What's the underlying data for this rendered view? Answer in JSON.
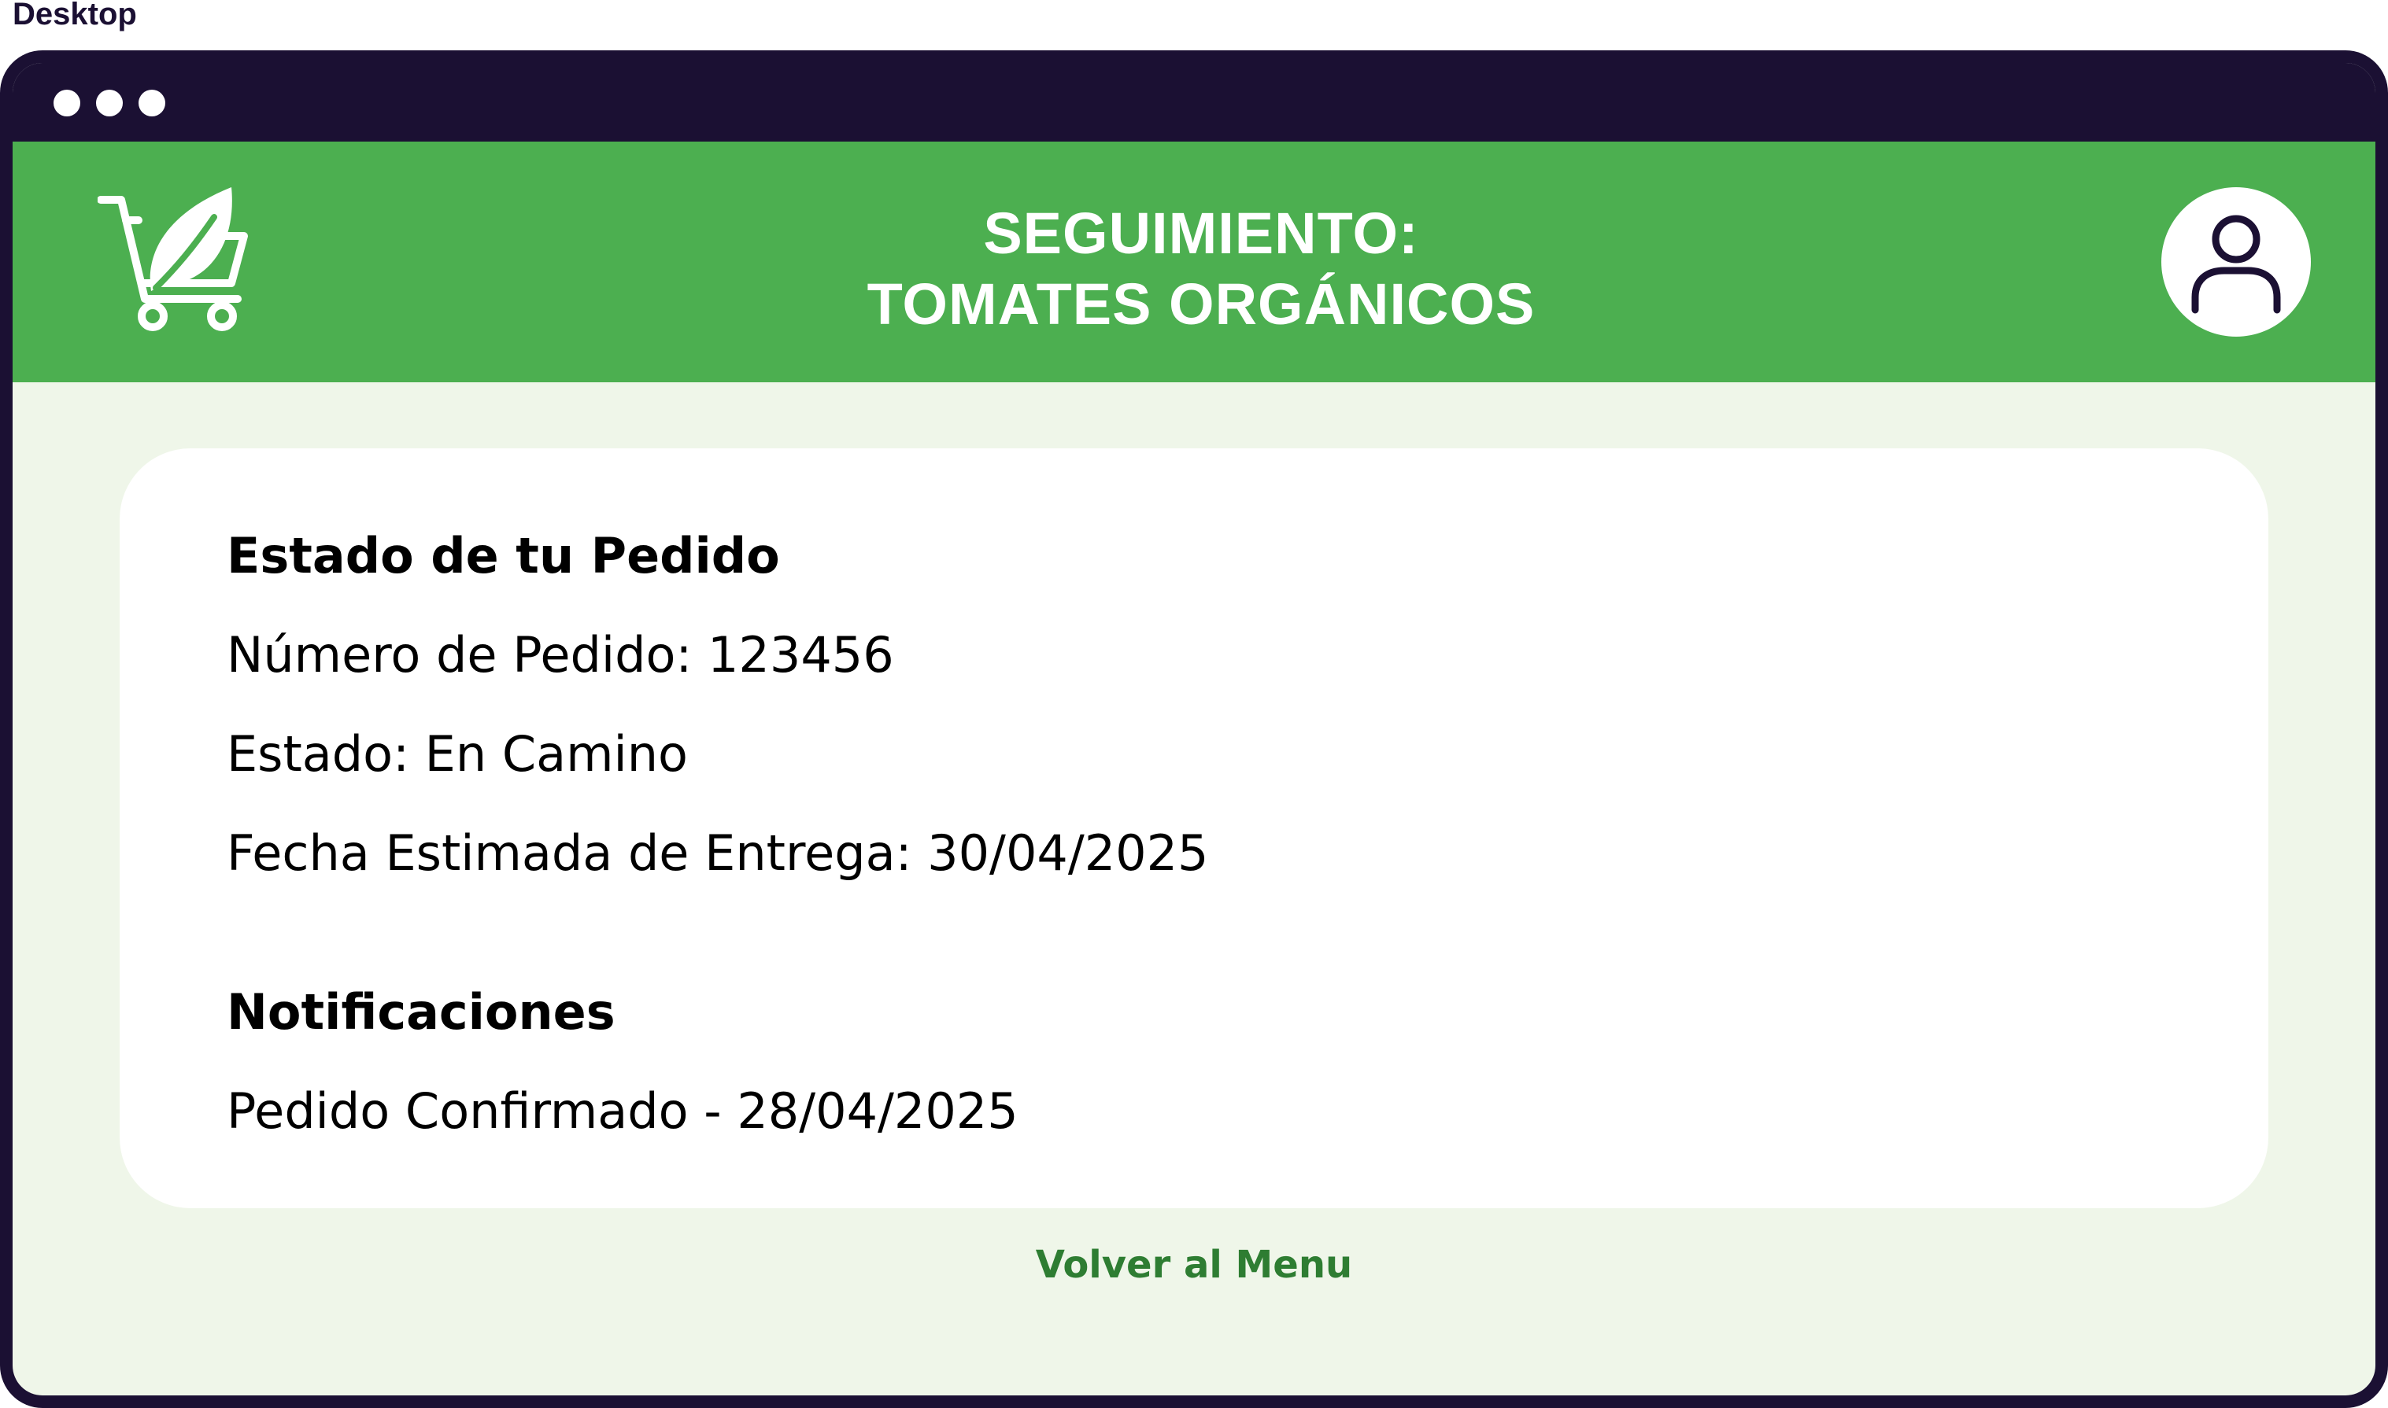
{
  "frame": {
    "label": "Desktop"
  },
  "header": {
    "title_line1": "SEGUIMIENTO:",
    "title_line2": "TOMATES ORGÁNICOS",
    "logo_icon": "shopping-cart-leaf-icon",
    "profile_icon": "user-icon"
  },
  "order_status": {
    "heading": "Estado de tu Pedido",
    "order_number": "Número de Pedido: 123456",
    "status": "Estado: En Camino",
    "estimated_delivery": "Fecha Estimada de Entrega: 30/04/2025"
  },
  "notifications": {
    "heading": "Notificaciones",
    "items": [
      "Pedido Confirmado - 28/04/2025"
    ]
  },
  "footer": {
    "back_link": "Volver al Menu"
  },
  "colors": {
    "frame": "#1b1033",
    "header_green": "#4caf50",
    "background": "#eff6e9",
    "link_green": "#2e7d32"
  }
}
